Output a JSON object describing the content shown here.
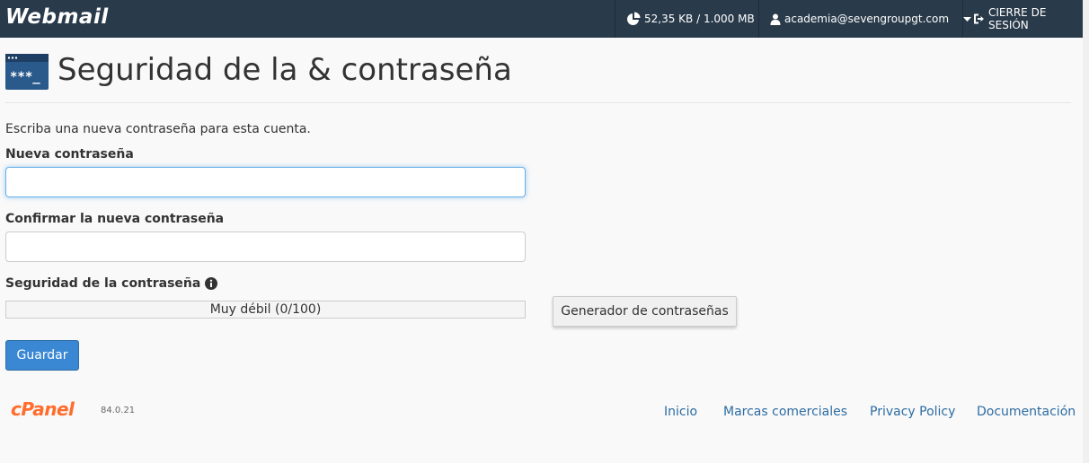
{
  "topbar": {
    "logo_text": "Webmail",
    "quota_text": "52,35 KB / 1.000 MB",
    "user_email": "academia@sevengroupgt.com",
    "logout_label": "CIERRE DE SESIÓN"
  },
  "page": {
    "title": "Seguridad de la & contraseña",
    "intro": "Escriba una nueva contraseña para esta cuenta."
  },
  "form": {
    "new_password_label": "Nueva contraseña",
    "new_password_value": "",
    "confirm_password_label": "Confirmar la nueva contraseña",
    "confirm_password_value": "",
    "strength_label": "Seguridad de la contraseña",
    "strength_text": "Muy débil (0/100)",
    "strength_score": 0,
    "generator_label": "Generador de contraseñas",
    "save_label": "Guardar"
  },
  "footer": {
    "logo_text": "cPanel",
    "version": "84.0.21",
    "links": [
      "Inicio",
      "Marcas comerciales",
      "Privacy Policy",
      "Documentación"
    ]
  },
  "colors": {
    "topbar_bg": "#293a4a",
    "primary_button": "#3a87d4",
    "link": "#2d6ca2",
    "cpanel_orange": "#ff6c2c"
  },
  "icons": {
    "quota": "pie-chart-icon",
    "user": "user-icon",
    "user_menu": "caret-down-icon",
    "logout": "sign-out-icon",
    "page": "password-window-icon",
    "strength_help": "info-circle-icon"
  }
}
